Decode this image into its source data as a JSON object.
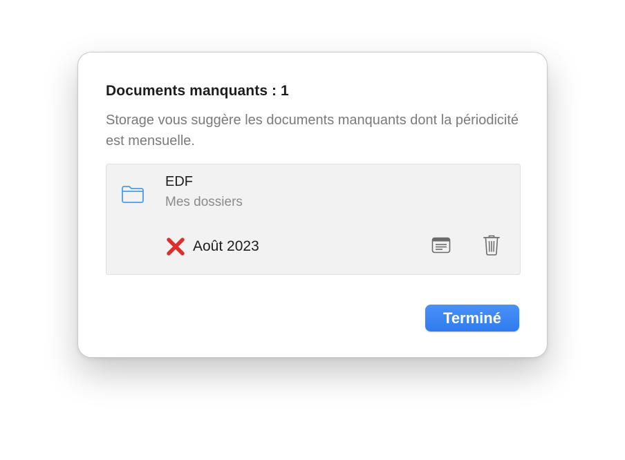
{
  "dialog": {
    "title": "Documents manquants : 1",
    "description": "Storage vous suggère les documents manquants dont la périodicité est mensuelle."
  },
  "item": {
    "icon": "folder-icon",
    "name": "EDF",
    "location": "Mes dossiers",
    "missing": {
      "status_icon": "red-x-icon",
      "label": "Août 2023"
    },
    "actions": [
      {
        "icon": "document-icon"
      },
      {
        "icon": "trash-icon"
      }
    ]
  },
  "footer": {
    "done_label": "Terminé"
  },
  "colors": {
    "accent": "#2f7cf0",
    "folder": "#4a9ae8",
    "error": "#d9302c",
    "card_bg": "#f2f2f2"
  }
}
